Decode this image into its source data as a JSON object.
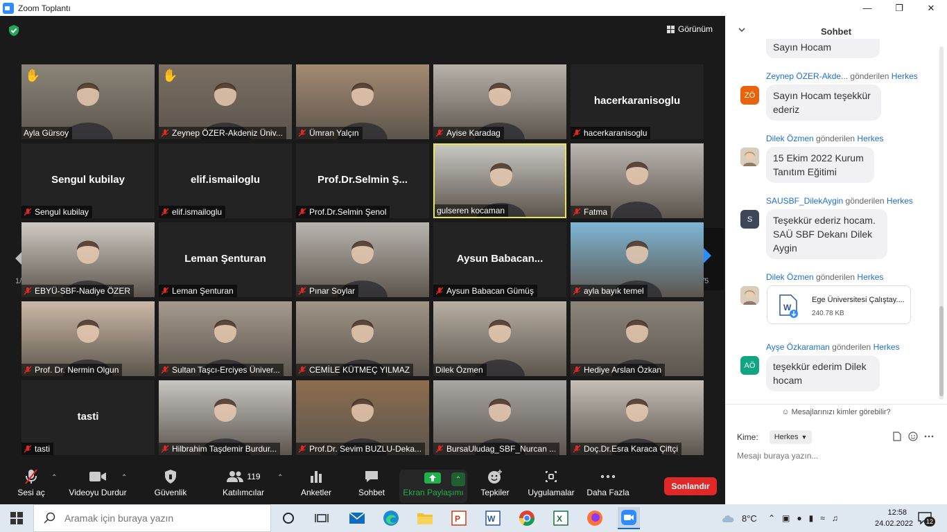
{
  "window": {
    "title": "Zoom Toplantı"
  },
  "header": {
    "view_label": "Görünüm"
  },
  "pager": {
    "left": "1/5",
    "right": "1/5"
  },
  "participants": [
    {
      "name": "Ayla Gürsoy",
      "muted": false,
      "video": true,
      "hand": true,
      "bg": "#8a8579"
    },
    {
      "name": "Zeynep ÖZER-Akdeniz Üniv...",
      "muted": true,
      "video": true,
      "hand": true,
      "bg": "#7a6e62"
    },
    {
      "name": "Ümran Yalçın",
      "muted": true,
      "video": true,
      "hand": false,
      "bg": "#a58a72"
    },
    {
      "name": "Ayise Karadag",
      "muted": true,
      "video": true,
      "hand": false,
      "bg": "#b7b2aa"
    },
    {
      "name": "hacerkaranisoglu",
      "muted": true,
      "video": false,
      "center": "hacerkaranisoglu"
    },
    {
      "name": "Sengul kubilay",
      "muted": true,
      "video": false,
      "center": "Sengul kubilay"
    },
    {
      "name": "elif.ismailoglu",
      "muted": true,
      "video": false,
      "center": "elif.ismailoglu"
    },
    {
      "name": "Prof.Dr.Selmin Şenol",
      "muted": true,
      "video": false,
      "center": "Prof.Dr.Selmin Ş..."
    },
    {
      "name": "gulseren kocaman",
      "muted": false,
      "video": true,
      "active": true,
      "bg": "#c9c7c2"
    },
    {
      "name": "Fatma",
      "muted": true,
      "video": true,
      "bg": "#bcb6b1"
    },
    {
      "name": "EBYÜ-SBF-Nadiye ÖZER",
      "muted": true,
      "video": true,
      "bg": "#cfcac3"
    },
    {
      "name": "Leman Şenturan",
      "muted": true,
      "video": false,
      "center": "Leman Şenturan"
    },
    {
      "name": "Pınar Soylar",
      "muted": true,
      "video": true,
      "bg": "#b9b5ae"
    },
    {
      "name": "Aysun Babacan Gümüş",
      "muted": true,
      "video": false,
      "center": "Aysun Babacan..."
    },
    {
      "name": "ayla bayık temel",
      "muted": true,
      "video": true,
      "bg": "#7eb6d6"
    },
    {
      "name": "Prof. Dr. Nermin Olgun",
      "muted": true,
      "video": true,
      "bg": "#cbb9a8"
    },
    {
      "name": "Sultan Taşcı-Erciyes Üniver...",
      "muted": true,
      "video": true,
      "bg": "#a59a8e"
    },
    {
      "name": "CEMİLE KÜTMEÇ YILMAZ",
      "muted": true,
      "video": true,
      "bg": "#9f9486"
    },
    {
      "name": "Dilek Özmen",
      "muted": false,
      "video": true,
      "bg": "#b8b0a4"
    },
    {
      "name": "Hediye Arslan Özkan",
      "muted": true,
      "video": true,
      "bg": "#8c857c"
    },
    {
      "name": "tasti",
      "muted": true,
      "video": false,
      "center": "tasti"
    },
    {
      "name": "Hilbrahim Taşdemir Burdur...",
      "muted": true,
      "video": true,
      "bg": "#c8c6c2"
    },
    {
      "name": "Prof.Dr. Sevim BUZLU-Deka...",
      "muted": true,
      "video": true,
      "bg": "#8d6d4e"
    },
    {
      "name": "BursaUludag_SBF_Nurcan ...",
      "muted": true,
      "video": true,
      "bg": "#a8a7a3"
    },
    {
      "name": "Doç.Dr.Esra Karaca Çiftçi",
      "muted": true,
      "video": true,
      "bg": "#c5bfb8"
    }
  ],
  "toolbar": {
    "mute": "Sesi aç",
    "video": "Videoyu Durdur",
    "security": "Güvenlik",
    "participants": "Katılımcılar",
    "participant_count": "119",
    "polls": "Anketler",
    "chat": "Sohbet",
    "share": "Ekran Paylaşımı",
    "reactions": "Tepkiler",
    "apps": "Uygulamalar",
    "more": "Daha Fazla",
    "end": "Sonlandır"
  },
  "chat": {
    "title": "Sohbet",
    "sent_word": "gönderilen",
    "recipient": "Herkes",
    "top_partial": "Sayın Hocam",
    "messages": [
      {
        "sender": "Zeynep ÖZER-Akde...",
        "initials": "ZÖ",
        "color": "#e8630a",
        "lines": [
          "Sayın Hocam teşekkür",
          "ederiz"
        ]
      },
      {
        "sender": "Dilek Özmen",
        "initials": "",
        "color": "#b8a48c",
        "lines": [
          "15 Ekim 2022 Kurum",
          "Tanıtım Eğitimi"
        ]
      },
      {
        "sender": "SAUSBF_DilekAygin",
        "initials": "S",
        "color": "#3c4858",
        "lines": [
          "Teşekkür ederiz hocam.",
          "SAÜ SBF Dekanı Dilek",
          "Aygin"
        ]
      },
      {
        "sender": "Dilek Özmen",
        "initials": "",
        "color": "#b8a48c",
        "file_name": "Ege Üniversitesi Çalıştay....",
        "file_size": "240.78 KB"
      },
      {
        "sender": "Ayşe Özkaraman",
        "initials": "AÖ",
        "color": "#11a582",
        "lines": [
          "teşekkür ederim Dilek",
          "hocam"
        ]
      }
    ],
    "who_can_see": "Mesajlarınızı kimler görebilir?",
    "to_label": "Kime:",
    "to_value": "Herkes",
    "input_placeholder": "Mesajı buraya yazın..."
  },
  "taskbar": {
    "search_placeholder": "Aramak için buraya yazın",
    "temperature": "8°C",
    "time": "12:58",
    "date": "24.02.2022",
    "notifications": "12"
  },
  "colors": {
    "accent": "#2d8cff",
    "end": "#e02828",
    "share": "#1fb24a",
    "active_border": "#e8e84a",
    "mute_red": "#e02828"
  }
}
